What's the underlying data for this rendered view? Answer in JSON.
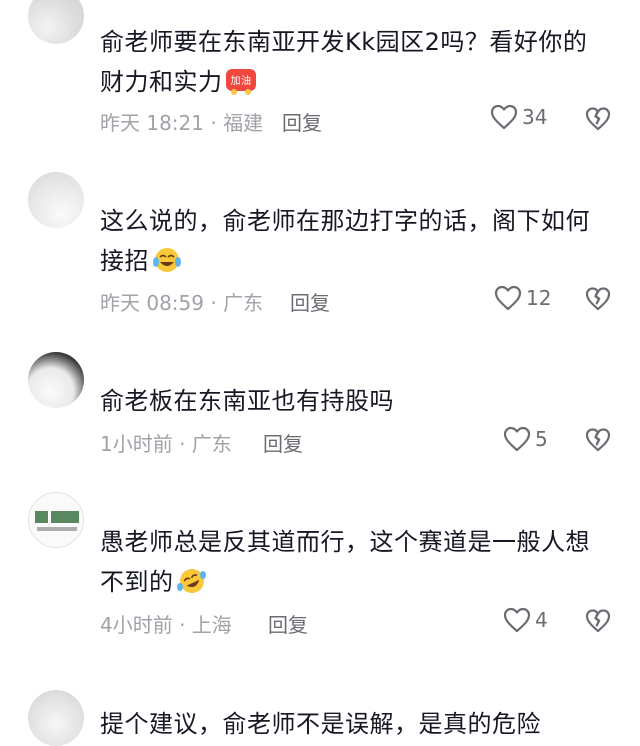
{
  "comments": [
    {
      "username": "",
      "text_line1": "俞老师要在东南亚开发Kk园区2吗？看好你的",
      "text_line2": "财力和实力",
      "emoji": "jiayou-emoji",
      "emoji_label": "加油",
      "time": "昨天 18:21",
      "location": "福建",
      "meta": "昨天 18:21 · 福建",
      "reply": "回复",
      "likes": "34"
    },
    {
      "username": "",
      "text_line1": "这么说的，俞老师在那边打字的话，阁下如何",
      "text_line2": "接招",
      "emoji": "tears-of-joy-emoji",
      "time": "昨天 08:59",
      "location": "广东",
      "meta": "昨天 08:59 · 广东",
      "reply": "回复",
      "likes": "12"
    },
    {
      "username": "",
      "text_line1": "俞老板在东南亚也有持股吗",
      "text_line2": "",
      "time": "1小时前",
      "location": "广东",
      "meta": "1小时前 · 广东",
      "reply": "回复",
      "likes": "5"
    },
    {
      "username": "",
      "text_line1": "愚老师总是反其道而行，这个赛道是一般人想",
      "text_line2": "不到的",
      "emoji": "rolling-laughing-emoji",
      "time": "4小时前",
      "location": "上海",
      "meta": "4小时前 · 上海",
      "reply": "回复",
      "likes": "4"
    },
    {
      "username": "",
      "text_line1": "提个建议，俞老师不是误解，是真的危险",
      "text_line2": ""
    }
  ],
  "icons": {
    "like": "heart-outline-icon",
    "dislike": "broken-heart-icon"
  },
  "colors": {
    "text": "#161823",
    "meta": "#a1a2a8",
    "action": "#6b6c72"
  }
}
